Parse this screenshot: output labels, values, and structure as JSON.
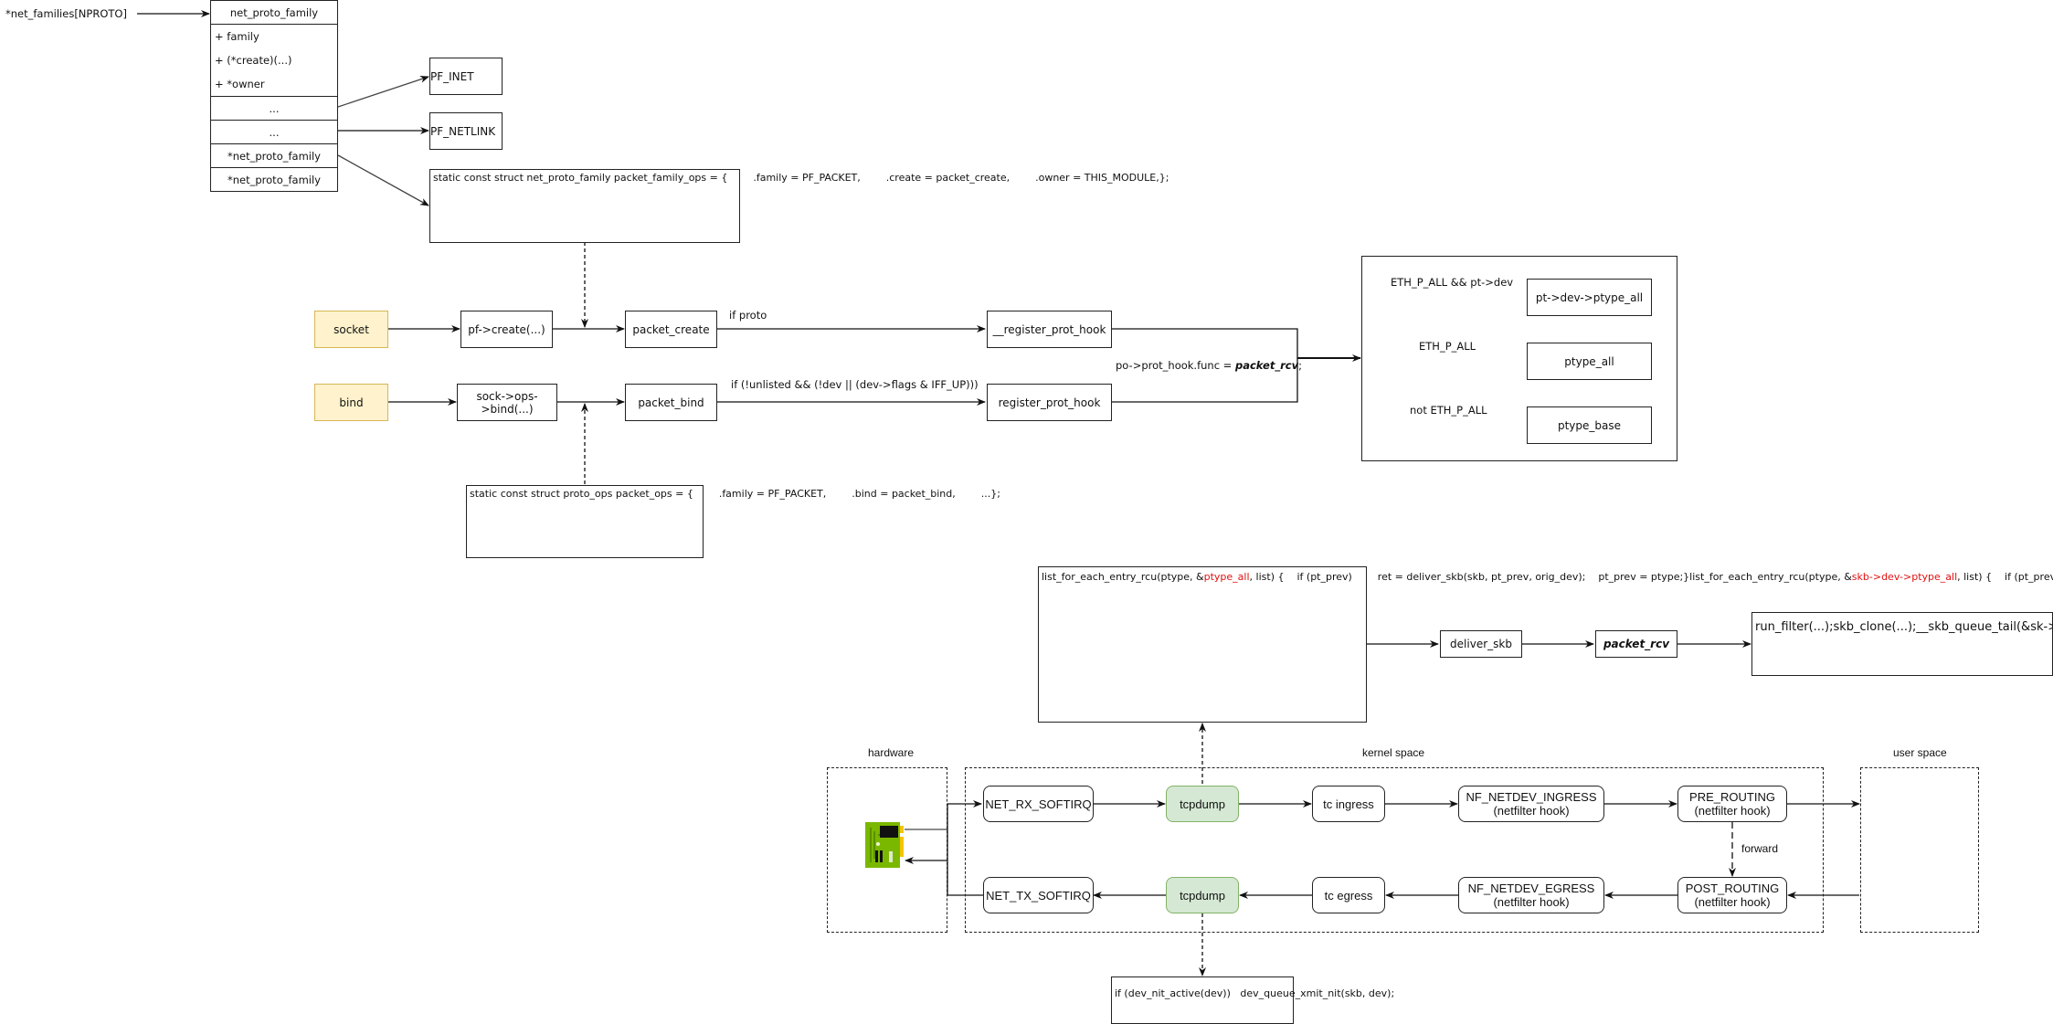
{
  "net_families": {
    "label": "*net_families[NPROTO]",
    "struct_title": "net_proto_family",
    "fields": [
      "+ family",
      "+ (*create)(...)",
      "+ *owner"
    ],
    "cells": [
      "...",
      "...",
      "*net_proto_family",
      "*net_proto_family"
    ]
  },
  "families": {
    "pf_inet": "PF_INET",
    "pf_netlink": "PF_NETLINK",
    "packet_family_ops": [
      "static const struct net_proto_family packet_family_ops = {",
      "        .family = PF_PACKET,",
      "        .create = packet_create,",
      "        .owner = THIS_MODULE,",
      "};"
    ]
  },
  "syscalls": {
    "socket": "socket",
    "bind": "bind",
    "pf_create": "pf->create(...)",
    "sock_ops_bind": "sock->ops->bind(...)",
    "packet_create": "packet_create",
    "packet_bind": "packet_bind",
    "if_proto": "if proto",
    "if_unlisted": "if (!unlisted && (!dev || (dev->flags & IFF_UP)))",
    "__register_prot_hook": "__register_prot_hook",
    "register_prot_hook": "register_prot_hook",
    "prot_hook_func_prefix": "po->prot_hook.func = ",
    "prot_hook_func_value": "packet_rcv",
    "prot_hook_func_suffix": ";",
    "packet_ops": [
      "static const struct proto_ops packet_ops = {",
      "        .family = PF_PACKET,",
      "        .bind = packet_bind,",
      "        ...",
      "};"
    ]
  },
  "ptype_lists": {
    "cond_dev": "ETH_P_ALL && pt->dev",
    "cond_all": "ETH_P_ALL",
    "cond_not": "not ETH_P_ALL",
    "dev_ptype_all": "pt->dev->ptype_all",
    "ptype_all": "ptype_all",
    "ptype_base": "ptype_base"
  },
  "rx_code": {
    "loop1_prefix": "list_for_each_entry_rcu(ptype, &",
    "loop1_highlight": "ptype_all",
    "loop1_suffix": ", list) {",
    "loop2_prefix": "list_for_each_entry_rcu(ptype, &",
    "loop2_highlight": "skb->dev->ptype_all",
    "loop2_suffix": ", list) {",
    "body": [
      "    if (pt_prev)",
      "        ret = deliver_skb(skb, pt_prev, orig_dev);",
      "    pt_prev = ptype;",
      "}"
    ],
    "highlight_color": "#e01010"
  },
  "delivery": {
    "deliver_skb": "deliver_skb",
    "packet_rcv": "packet_rcv",
    "result": [
      "run_filter(...);",
      "skb_clone(...);",
      "__skb_queue_tail(&sk->sk_receive_queue, skb);"
    ]
  },
  "path": {
    "hardware": "hardware",
    "kernel_space": "kernel space",
    "user_space": "user space",
    "net_rx_softirq": "NET_RX_SOFTIRQ",
    "net_tx_softirq": "NET_TX_SOFTIRQ",
    "tcpdump_rx": "tcpdump",
    "tcpdump_tx": "tcpdump",
    "tc_ingress": "tc ingress",
    "tc_egress": "tc egress",
    "nf_netdev_ingress": "NF_NETDEV_INGRESS",
    "nf_netdev_egress": "NF_NETDEV_EGRESS",
    "pre_routing": "PRE_ROUTING",
    "post_routing": "POST_ROUTING",
    "netfilter_hook": "(netfilter hook)",
    "forward": "forward",
    "tcpdump_color": "#d5e8d4",
    "syscall_color": "#fff2cc",
    "nic_color": "#7ab800"
  },
  "tx_code": [
    "if (dev_nit_active(dev))",
    "   dev_queue_xmit_nit(skb, dev);"
  ]
}
